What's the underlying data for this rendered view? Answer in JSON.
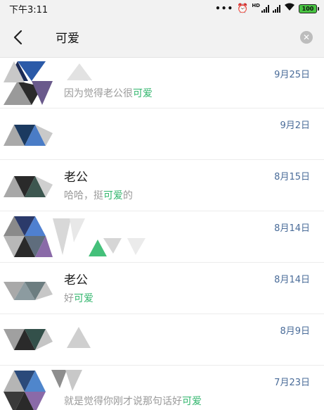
{
  "status_bar": {
    "time": "下午3:11",
    "battery": "100"
  },
  "search": {
    "query": "可爱"
  },
  "results": [
    {
      "name": "",
      "snippet_pre": "因为觉得老公很",
      "highlight": "可爱",
      "snippet_post": "",
      "date": "9月25日"
    },
    {
      "name": "",
      "snippet_pre": "",
      "highlight": "",
      "snippet_post": "",
      "date": "9月2日"
    },
    {
      "name": "老公",
      "snippet_pre": "哈哈，挺",
      "highlight": "可爱",
      "snippet_post": "的",
      "date": "8月15日"
    },
    {
      "name": "",
      "snippet_pre": "",
      "highlight": "",
      "snippet_post": "",
      "date": "8月14日"
    },
    {
      "name": "老公",
      "snippet_pre": "好",
      "highlight": "可爱",
      "snippet_post": "",
      "date": "8月14日"
    },
    {
      "name": "",
      "snippet_pre": "",
      "highlight": "",
      "snippet_post": "",
      "date": "8月9日"
    },
    {
      "name": "",
      "snippet_pre": "就是觉得你刚才说那句话好",
      "highlight": "可爱",
      "snippet_post": "",
      "date": "7月23日"
    }
  ],
  "colors": {
    "highlight": "#2fb56b",
    "date": "#4a6c99",
    "header_bg": "#f2f2f2"
  }
}
